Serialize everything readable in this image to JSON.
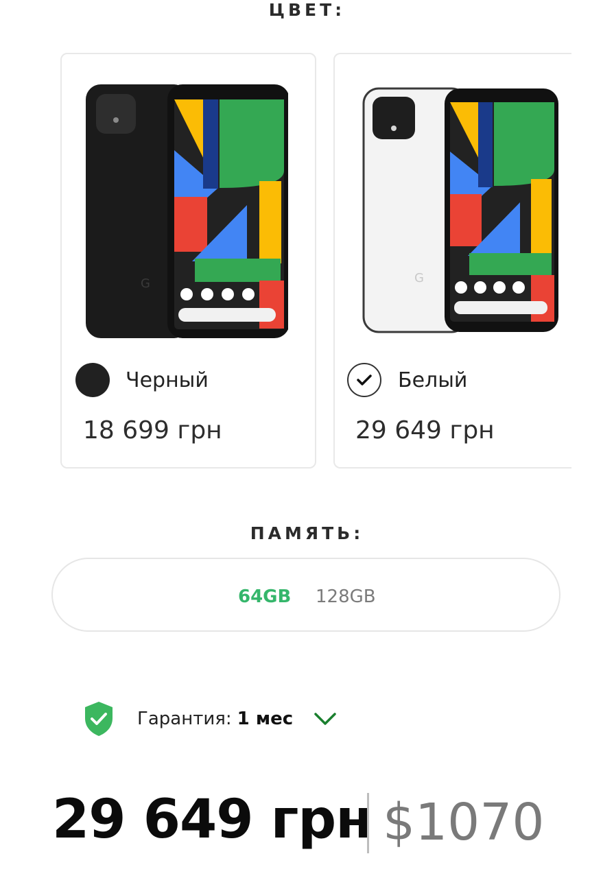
{
  "color_section": {
    "title": "ЦВЕТ:",
    "options": [
      {
        "name": "Черный",
        "price": "18 699 грн",
        "swatch": "#212121",
        "selected": false
      },
      {
        "name": "Белый",
        "price": "29 649 грн",
        "swatch": "#ffffff",
        "selected": true
      }
    ]
  },
  "memory_section": {
    "title": "ПАМЯТЬ:",
    "options": [
      {
        "label": "64GB",
        "selected": true
      },
      {
        "label": "128GB",
        "selected": false
      }
    ],
    "selected_color": "#35b66b"
  },
  "warranty": {
    "label": "Гарантия:",
    "value": "1 мес",
    "icon": "shield-check-icon",
    "accent": "#3cb75f"
  },
  "price": {
    "main": "29 649 грн",
    "usd": "$1070"
  }
}
